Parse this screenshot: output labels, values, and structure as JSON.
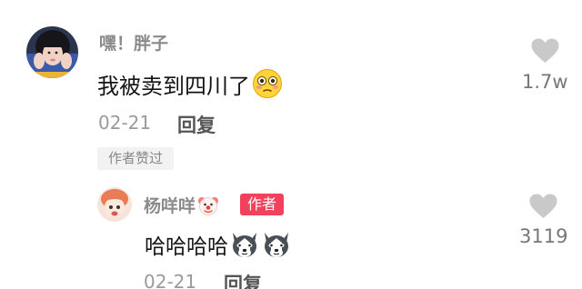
{
  "comments": [
    {
      "username": "嘿！胖子",
      "text": "我被卖到四川了",
      "emoji": "flushed-face-emoji",
      "date": "02-21",
      "reply_label": "回复",
      "author_liked_tag": "作者赞过",
      "like_count": "1.7w"
    },
    {
      "username": "杨咩咩",
      "name_emoji": "clown-face-emoji",
      "badge": "作者",
      "text": "哈哈哈哈",
      "emojis": [
        "husky-dog-emoji",
        "husky-dog-emoji"
      ],
      "date": "02-21",
      "reply_label": "回复",
      "like_count": "3119"
    }
  ],
  "colors": {
    "username": "#8a8a8a",
    "text": "#141414",
    "meta": "#9a9a9a",
    "heart": "#c9c9c9",
    "author_badge": "#f2405d"
  }
}
